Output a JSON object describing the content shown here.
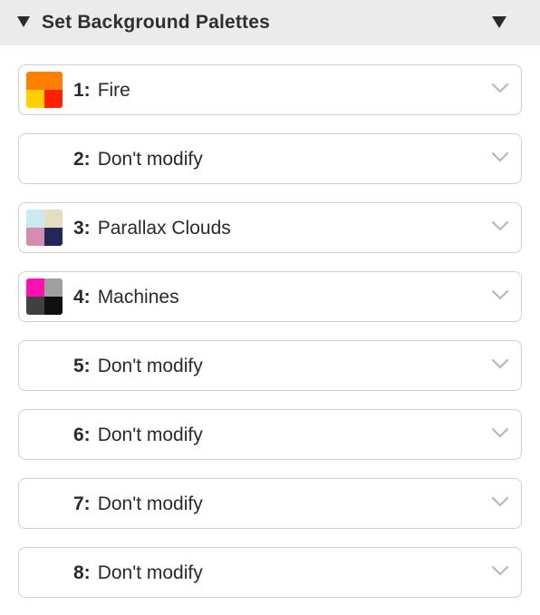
{
  "panel": {
    "title": "Set Background Palettes"
  },
  "rows": [
    {
      "number": "1:",
      "name": "Fire",
      "swatch": [
        "#ff7f00",
        "#ff7f00",
        "#ffd000",
        "#ff2000"
      ]
    },
    {
      "number": "2:",
      "name": "Don't modify",
      "swatch": null
    },
    {
      "number": "3:",
      "name": "Parallax Clouds",
      "swatch": [
        "#cce8f4",
        "#e8dcc0",
        "#d48cb0",
        "#222858"
      ]
    },
    {
      "number": "4:",
      "name": "Machines",
      "swatch": [
        "#ff10b0",
        "#a0a0a0",
        "#404040",
        "#101010"
      ]
    },
    {
      "number": "5:",
      "name": "Don't modify",
      "swatch": null
    },
    {
      "number": "6:",
      "name": "Don't modify",
      "swatch": null
    },
    {
      "number": "7:",
      "name": "Don't modify",
      "swatch": null
    },
    {
      "number": "8:",
      "name": "Don't modify",
      "swatch": null
    }
  ],
  "icons": {
    "collapse": "disclosure-triangle-icon",
    "menu": "menu-triangle-icon",
    "dropdown": "chevron-down-icon"
  }
}
